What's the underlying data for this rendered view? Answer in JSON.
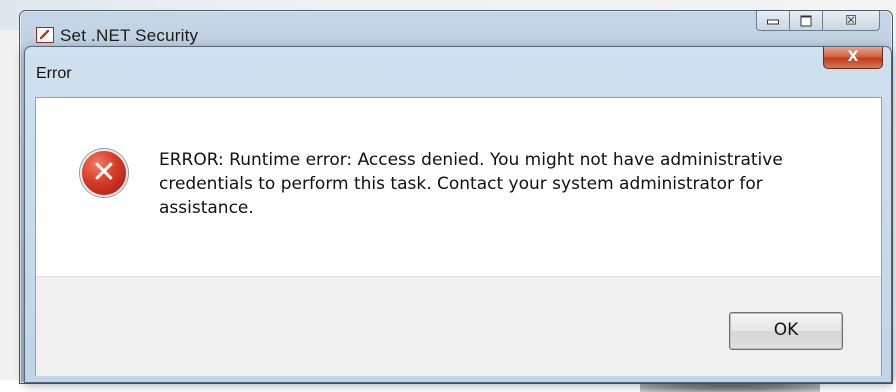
{
  "parent_window": {
    "title": "Set .NET Security",
    "minimize_icon": "minimize-icon",
    "maximize_icon": "maximize-icon",
    "close_icon": "close-icon",
    "close_glyph": "☒"
  },
  "dialog": {
    "title": "Error",
    "close_glyph": "X",
    "icon": "error-icon",
    "icon_glyph": "✕",
    "message": "ERROR: Runtime error: Access denied. You might not have administrative credentials to perform this task. Contact your system administrator for assistance.",
    "ok_label": "OK"
  },
  "colors": {
    "error_red": "#d63a26",
    "close_button_red": "#c8482a",
    "frame_blue": "#c1d5e8"
  }
}
